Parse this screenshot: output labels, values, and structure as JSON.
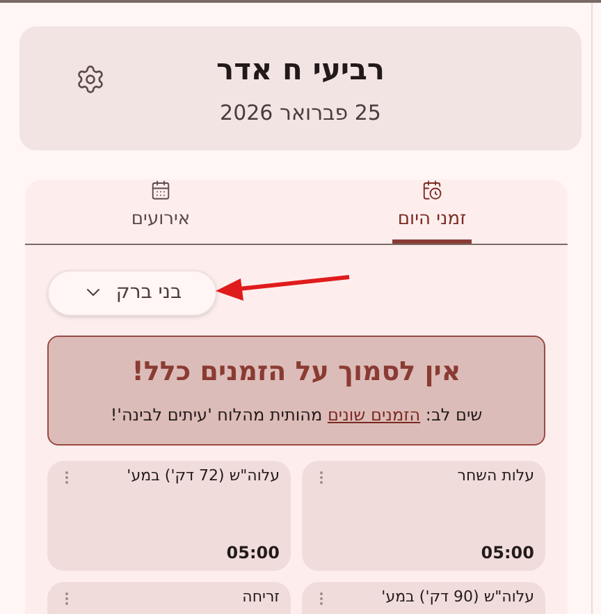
{
  "header": {
    "title": "רביעי ח אדר",
    "date": "25 פברואר 2026"
  },
  "tabs": [
    {
      "label": "זמני היום",
      "selected": true,
      "kind": "clock"
    },
    {
      "label": "אירועים",
      "selected": false,
      "kind": "calendar"
    }
  ],
  "location": {
    "value": "בני ברק"
  },
  "warning": {
    "title": "אין לסמוך על הזמנים כלל!",
    "before": "שים לב: ",
    "link": "הזמנים שונים",
    "after": " מהותית מהלוח 'עיתים לבינה'!"
  },
  "times": [
    {
      "name": "עלות השחר",
      "time": "05:00"
    },
    {
      "name": "עלוה\"ש (72 דק') במע'",
      "time": "05:00"
    },
    {
      "name": "עלוה\"ש (90 דק') במע'"
    },
    {
      "name": "זריחה"
    }
  ]
}
